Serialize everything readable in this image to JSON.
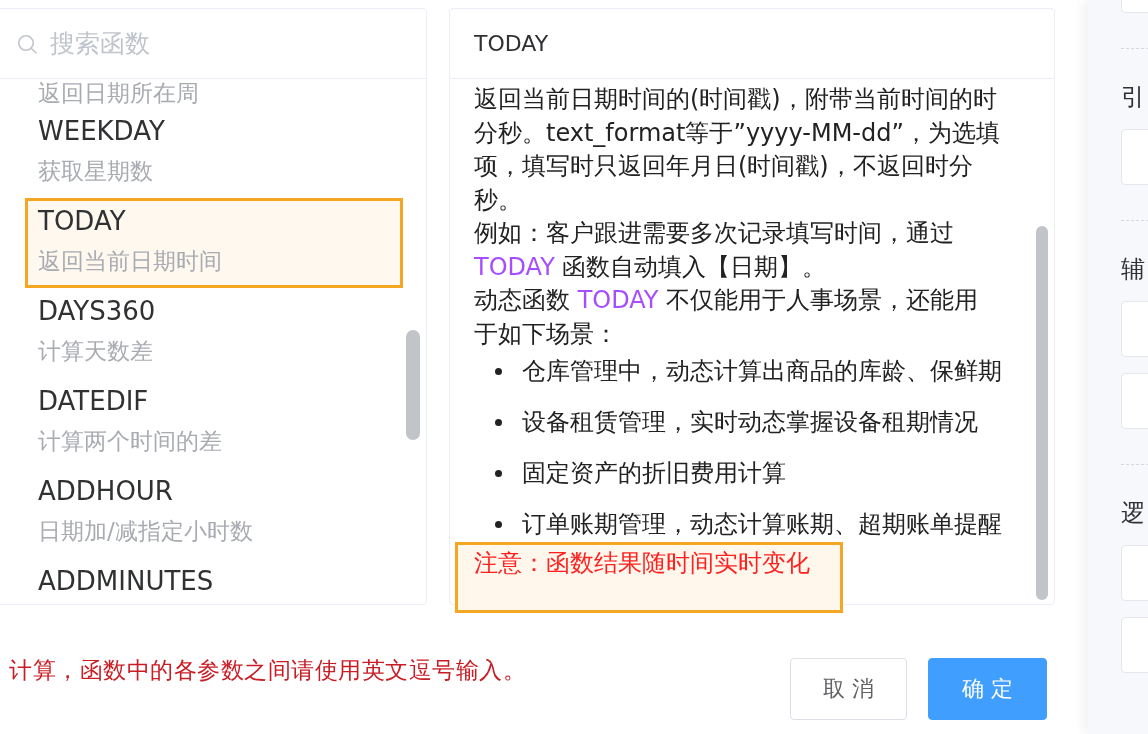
{
  "function_list": {
    "search": {
      "placeholder": "搜索函数"
    },
    "items": [
      {
        "description": "返回日期所在周",
        "selected": false
      },
      {
        "name": "WEEKDAY",
        "description": "获取星期数",
        "selected": false
      },
      {
        "name": "TODAY",
        "description": "返回当前日期时间",
        "selected": true
      },
      {
        "name": "DAYS360",
        "description": "计算天数差",
        "selected": false
      },
      {
        "name": "DATEDIF",
        "description": "计算两个时间的差",
        "selected": false
      },
      {
        "name": "ADDHOUR",
        "description": "日期加/减指定小时数",
        "selected": false
      },
      {
        "name": "ADDMINUTES",
        "selected": false
      }
    ]
  },
  "function_detail": {
    "title": "TODAY",
    "paragraphs": [
      {
        "parts": [
          {
            "kind": "text",
            "text": "返回当前日期时间的(时间戳)，附带当前时间的时分秒。text_format等于”yyyy-MM-dd”，为选填项，填写时只返回年月日(时间戳)，不返回时分秒。"
          }
        ]
      },
      {
        "parts": [
          {
            "kind": "text",
            "text": "例如：客户跟进需要多次记录填写时间，通过 "
          },
          {
            "kind": "function",
            "text": "TODAY"
          },
          {
            "kind": "text",
            "text": " 函数自动填入【日期】。"
          }
        ]
      },
      {
        "parts": [
          {
            "kind": "text",
            "text": "动态函数 "
          },
          {
            "kind": "function",
            "text": "TODAY"
          },
          {
            "kind": "text",
            "text": " 不仅能用于人事场景，还能用于如下场景："
          }
        ]
      }
    ],
    "bullets": [
      "仓库管理中，动态计算出商品的库龄、保鲜期",
      "设备租赁管理，实时动态掌握设备租期情况",
      "固定资产的折旧费用计算",
      "订单账期管理，动态计算账期、超期账单提醒"
    ],
    "note": {
      "text": "注意：函数结果随时间实时变化",
      "highlighted": true
    }
  },
  "footer": {
    "hint": "计算，函数中的各参数之间请使用英文逗号输入。",
    "buttons": [
      {
        "label": "取 消",
        "kind": "default"
      },
      {
        "label": "确 定",
        "kind": "primary"
      }
    ]
  },
  "side_panel": {
    "sections": [
      {
        "cards": [
          {
            "kind": "card"
          }
        ]
      },
      {
        "heading": "引",
        "cards": [
          {
            "kind": "card"
          }
        ]
      },
      {
        "heading": "辅",
        "cards": [
          {
            "kind": "card"
          },
          {
            "kind": "card"
          }
        ]
      },
      {
        "heading": "逻",
        "cards": [
          {
            "kind": "card"
          },
          {
            "kind": "card"
          }
        ]
      }
    ]
  }
}
